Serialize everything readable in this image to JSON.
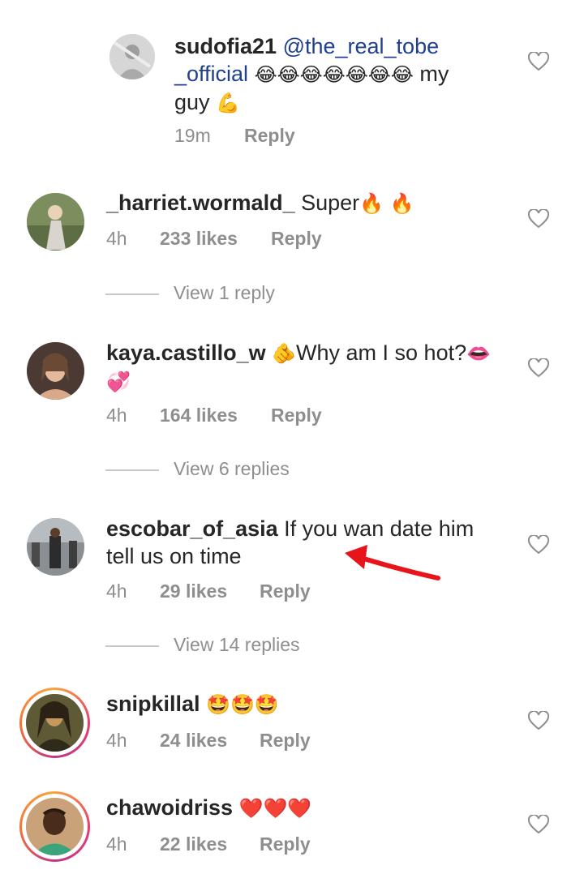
{
  "comments": [
    {
      "username": "sudofia21",
      "mention": "@the_real_tobe",
      "mention2": "_official",
      "text_end": "my",
      "text_line3": "guy",
      "emoji": "😂😂😂😂😂😂😂",
      "emoji2": "💪",
      "time": "19m",
      "likes": "",
      "reply": "Reply"
    },
    {
      "username": "_harriet.wormald_",
      "text": "Super",
      "emoji": "🔥 🔥",
      "time": "4h",
      "likes": "233 likes",
      "reply": "Reply",
      "view_replies": "View 1 reply"
    },
    {
      "username": "kaya.castillo_w",
      "emoji_lead": "🫵",
      "text": "Why am I so hot?",
      "emoji": "👄",
      "emoji2": "💞",
      "time": "4h",
      "likes": "164 likes",
      "reply": "Reply",
      "view_replies": "View 6 replies"
    },
    {
      "username": "escobar_of_asia",
      "text": "If you wan date him",
      "text2": "tell us on time",
      "time": "4h",
      "likes": "29 likes",
      "reply": "Reply",
      "view_replies": "View 14 replies"
    },
    {
      "username": "snipkillal",
      "emoji": "🤩🤩🤩",
      "time": "4h",
      "likes": "24 likes",
      "reply": "Reply"
    },
    {
      "username": "chawoidriss",
      "emoji": "❤️❤️❤️",
      "time": "4h",
      "likes": "22 likes",
      "reply": "Reply"
    }
  ],
  "colors": {
    "text": "#262626",
    "muted": "#8e8e8e",
    "mention": "#1f3f8f",
    "annotation_arrow": "#e8141c",
    "story_ring": "#e53e6f"
  },
  "icons": {
    "like": "heart-outline-icon"
  }
}
